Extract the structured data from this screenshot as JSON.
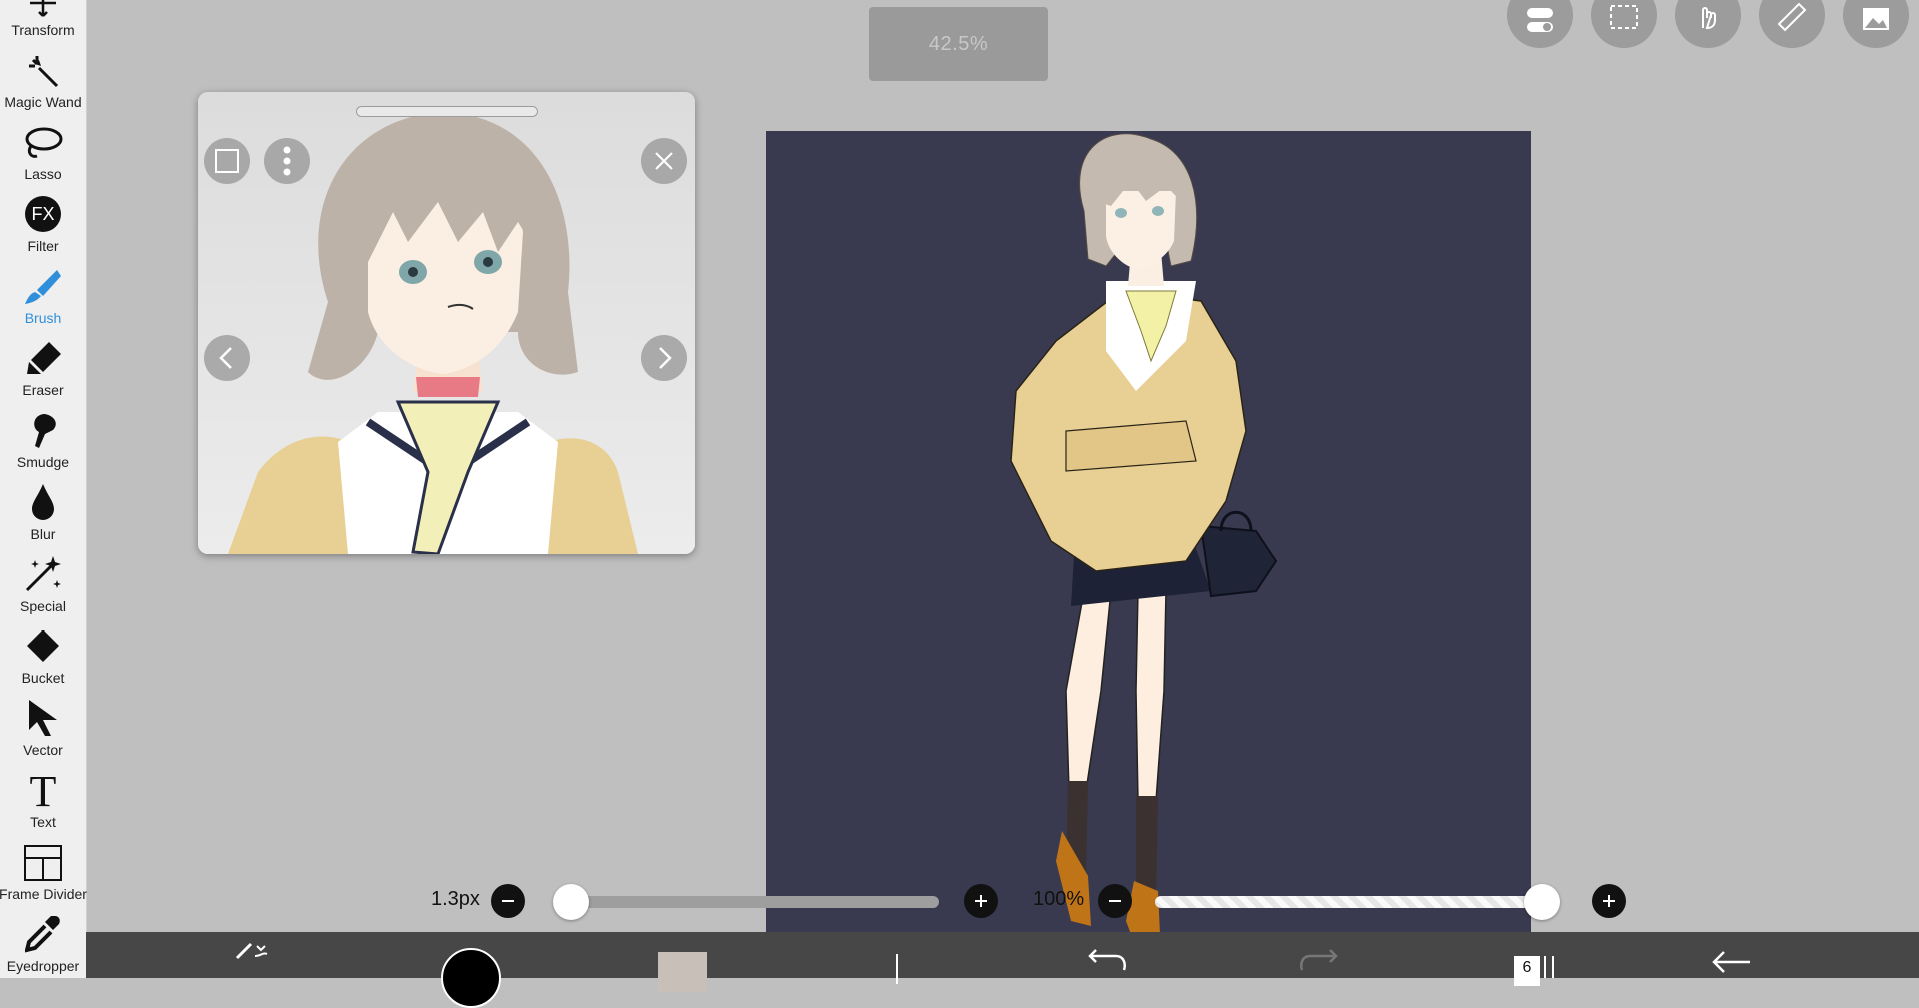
{
  "toolbar": {
    "items": [
      {
        "label": "Transform",
        "icon": "transform-icon"
      },
      {
        "label": "Magic Wand",
        "icon": "magic-wand-icon"
      },
      {
        "label": "Lasso",
        "icon": "lasso-icon"
      },
      {
        "label": "Filter",
        "icon": "fx-icon"
      },
      {
        "label": "Brush",
        "icon": "brush-icon",
        "active": true
      },
      {
        "label": "Eraser",
        "icon": "eraser-icon"
      },
      {
        "label": "Smudge",
        "icon": "smudge-icon"
      },
      {
        "label": "Blur",
        "icon": "blur-drop-icon"
      },
      {
        "label": "Special",
        "icon": "sparkle-icon"
      },
      {
        "label": "Bucket",
        "icon": "bucket-icon"
      },
      {
        "label": "Vector",
        "icon": "cursor-arrow-icon"
      },
      {
        "label": "Text",
        "icon": "text-T-icon"
      },
      {
        "label": "Frame Divider",
        "icon": "frame-divider-icon"
      },
      {
        "label": "Eyedropper",
        "icon": "eyedropper-icon"
      }
    ],
    "fx_text": "FX",
    "text_glyph": "T",
    "active_color": "#2f8fdb"
  },
  "zoom": {
    "level": "42.5%"
  },
  "top_buttons": [
    "toggle-icon",
    "selection-icon",
    "hand-icon",
    "ruler-icon",
    "image-icon"
  ],
  "reference_window": {
    "buttons": [
      "square-icon",
      "more-vertical-icon",
      "close-icon",
      "chevron-left-icon",
      "chevron-right-icon"
    ]
  },
  "canvas": {
    "background": "#393a4f"
  },
  "brush_size": {
    "value": "1.3px",
    "level": 0.0
  },
  "opacity": {
    "value": "100%",
    "level": 1.0
  },
  "bottom_bar": {
    "layer_count": "6",
    "color": "#000000",
    "secondary_color": "#c8bfb8",
    "items": [
      "brush-settings-icon",
      "color-swatch",
      "secondary-swatch",
      "undo-icon",
      "redo-icon",
      "layers-icon",
      "back-icon"
    ]
  }
}
